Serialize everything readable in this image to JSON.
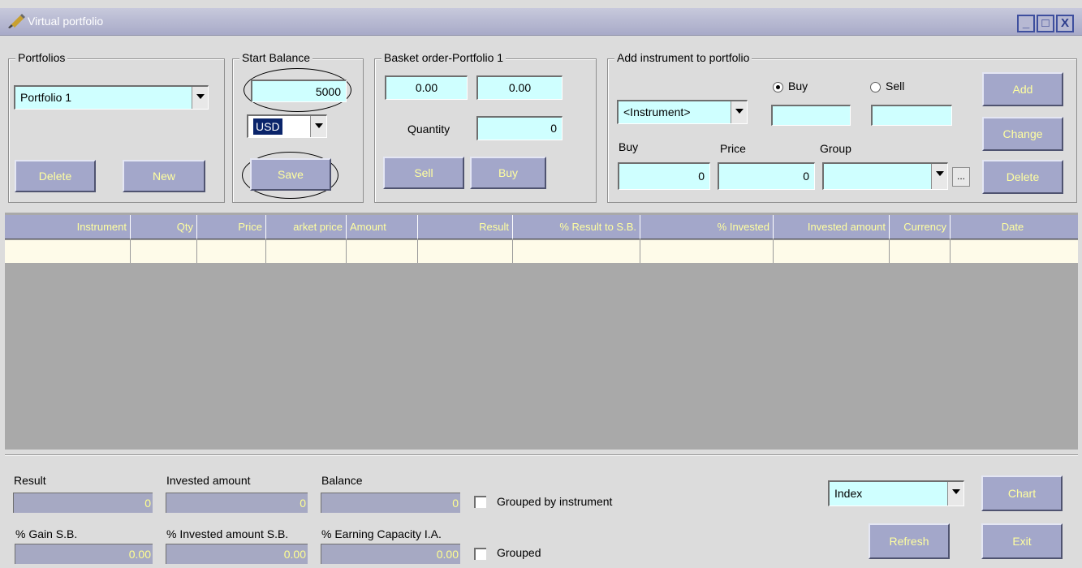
{
  "window": {
    "title": "Virtual portfolio"
  },
  "portfolios": {
    "title": "Portfolios",
    "selected": "Portfolio 1",
    "delete_label": "Delete",
    "new_label": "New"
  },
  "start_balance": {
    "title": "Start Balance",
    "amount": "5000",
    "currency": "USD",
    "save_label": "Save"
  },
  "basket": {
    "title": "Basket order-Portfolio 1",
    "value1": "0.00",
    "value2": "0.00",
    "quantity_label": "Quantity",
    "quantity": "0",
    "sell_label": "Sell",
    "buy_label": "Buy"
  },
  "add_instrument": {
    "title": "Add instrument to portfolio",
    "instrument": "<Instrument>",
    "buy_radio": "Buy",
    "sell_radio": "Sell",
    "buy_label": "Buy",
    "price_label": "Price",
    "group_label": "Group",
    "buy_value": "0",
    "price_value": "0",
    "ellipsis": "...",
    "add_label": "Add",
    "change_label": "Change",
    "delete_label": "Delete"
  },
  "table": {
    "columns": [
      "Instrument",
      "Qty",
      "Price",
      "arket price",
      "Amount",
      "Result",
      "% Result to S.B.",
      "% Invested",
      "Invested amount",
      "Currency",
      "Date"
    ]
  },
  "summary": {
    "result_label": "Result",
    "result_value": "0",
    "invested_label": "Invested amount",
    "invested_value": "0",
    "balance_label": "Balance",
    "balance_value": "0",
    "grouped_by_instrument": "Grouped by instrument",
    "gain_label": "% Gain S.B.",
    "gain_value": "0.00",
    "invested_sb_label": "% Invested amount S.B.",
    "invested_sb_value": "0.00",
    "earning_label": "% Earning Capacity I.A.",
    "earning_value": "0.00",
    "grouped": "Grouped",
    "index_select": "Index",
    "chart_label": "Chart",
    "refresh_label": "Refresh",
    "exit_label": "Exit"
  }
}
